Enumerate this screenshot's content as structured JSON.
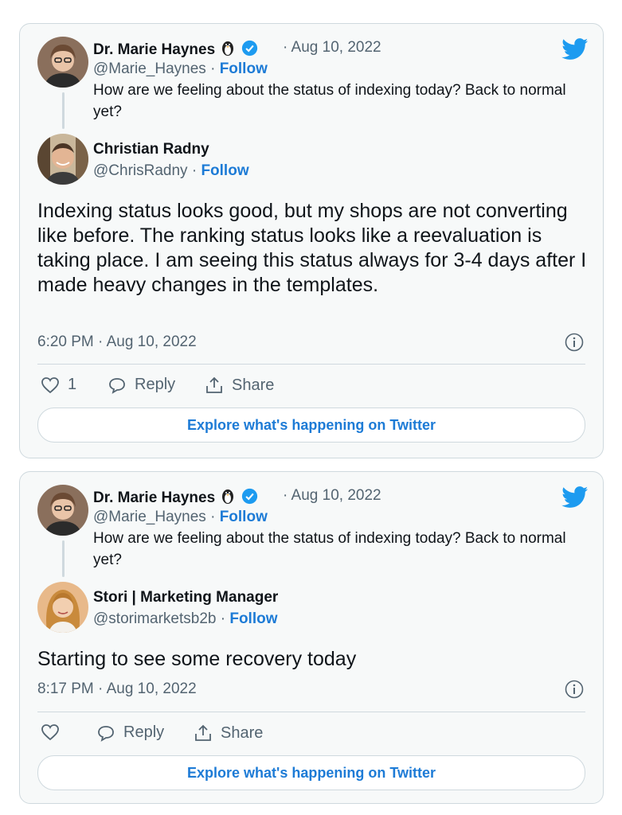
{
  "colors": {
    "link": "#1d7bd6",
    "twitter_blue": "#1d9bf0",
    "muted": "#536471",
    "border": "#cfd9de"
  },
  "tweets": [
    {
      "quoted": {
        "author_name": "Dr. Marie Haynes",
        "emoji_icon": "penguin-icon",
        "verified_icon": "verified-badge-icon",
        "date": "· Aug 10, 2022",
        "handle": "@Marie_Haynes",
        "separator": "·",
        "follow_label": "Follow",
        "text": "How are we feeling about the status of indexing today? Back to normal yet?"
      },
      "reply": {
        "author_name": "Christian Radny",
        "handle": "@ChrisRadny",
        "separator": "·",
        "follow_label": "Follow",
        "text": "Indexing status looks good, but my shops are not converting like before. The ranking status looks like a reevaluation is taking place. I am seeing this status always for 3-4 days after I made heavy changes in the templates.",
        "timestamp": "6:20 PM · Aug 10, 2022"
      },
      "actions": {
        "like_count": "1",
        "reply_label": "Reply",
        "share_label": "Share"
      },
      "explore_label": "Explore what's happening on Twitter"
    },
    {
      "quoted": {
        "author_name": "Dr. Marie Haynes",
        "emoji_icon": "penguin-icon",
        "verified_icon": "verified-badge-icon",
        "date": "· Aug 10, 2022",
        "handle": "@Marie_Haynes",
        "separator": "·",
        "follow_label": "Follow",
        "text": "How are we feeling about the status of indexing today? Back to normal yet?"
      },
      "reply": {
        "author_name": "Stori | Marketing Manager",
        "handle": "@storimarketsb2b",
        "separator": "·",
        "follow_label": "Follow",
        "text": "Starting to see some recovery today",
        "timestamp": "8:17 PM · Aug 10, 2022"
      },
      "actions": {
        "like_count": "",
        "reply_label": "Reply",
        "share_label": "Share"
      },
      "explore_label": "Explore what's happening on Twitter"
    }
  ]
}
